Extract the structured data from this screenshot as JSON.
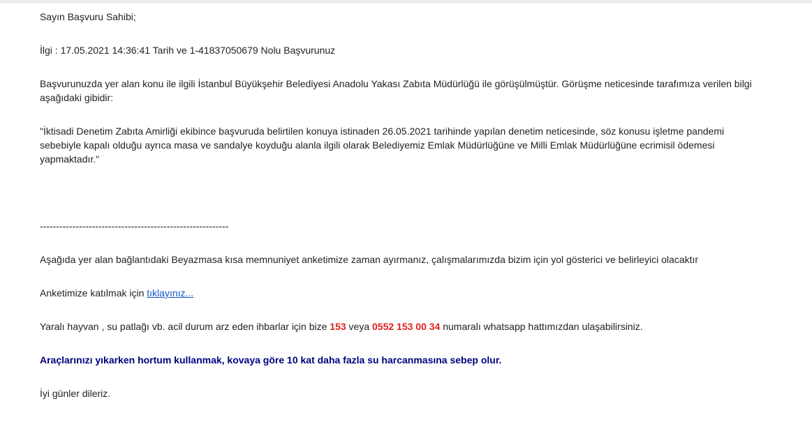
{
  "email": {
    "greeting": "Sayın Başvuru Sahibi;",
    "subject_line": "İlgi : 17.05.2021 14:36:41 Tarih ve 1-41837050679 Nolu Başvurunuz",
    "intro": "Başvurunuzda yer alan konu ile ilgili İstanbul Büyükşehir Belediyesi Anadolu Yakası Zabıta Müdürlüğü ile görüşülmüştür. Görüşme neticesinde tarafımıza verilen bilgi aşağıdaki gibidir:",
    "quote": "\"İktisadi Denetim Zabıta Amirliği ekibince başvuruda belirtilen konuya istinaden 26.05.2021 tarihinde yapılan denetim neticesinde, söz konusu işletme pandemi sebebiyle kapalı olduğu ayrıca masa ve sandalye koyduğu alanla ilgili olarak  Belediyemiz Emlak Müdürlüğüne ve Milli Emlak Müdürlüğüne ecrimisil ödemesi yapmaktadır.\"",
    "separator": "----------------------------------------------------------",
    "survey_text": "Aşağıda yer alan bağlantıdaki Beyazmasa kısa memnuniyet anketimize zaman ayırmanız, çalışmalarımızda bizim için yol gösterici ve belirleyici olacaktır",
    "survey_prompt": "Anketimize katılmak için ",
    "survey_link": "tıklayınız...",
    "emergency_before": "Yaralı hayvan , su patlağı vb. acil durum arz eden ihbarlar için bize  ",
    "emergency_number_1": "153",
    "emergency_middle": " veya ",
    "emergency_number_2": "0552 153 00 34",
    "emergency_after": " numaralı whatsapp hattımızdan ulaşabilirsiniz.",
    "water_notice": "Araçlarınızı yıkarken hortum kullanmak, kovaya göre 10 kat daha fazla su harcanmasına sebep olur.",
    "closing": "İyi günler dileriz.",
    "colors": {
      "link": "#1155cc",
      "emergency": "#e02020",
      "notice": "#000080"
    }
  }
}
